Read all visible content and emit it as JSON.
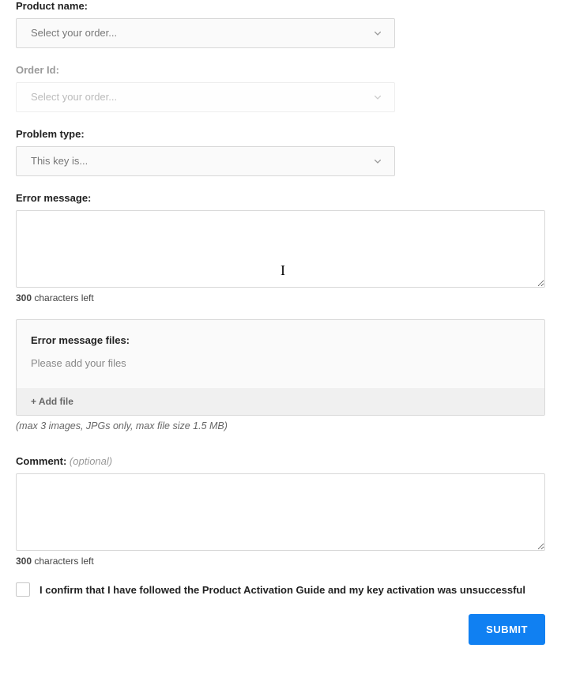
{
  "productName": {
    "label": "Product name:",
    "placeholder": "Select your order..."
  },
  "orderId": {
    "label": "Order Id:",
    "placeholder": "Select your order..."
  },
  "problemType": {
    "label": "Problem type:",
    "placeholder": "This key is..."
  },
  "errorMessage": {
    "label": "Error message:",
    "counterCount": "300",
    "counterText": " characters left"
  },
  "errorFiles": {
    "label": "Error message files:",
    "hint": "Please add your files",
    "addFile": "+ Add file",
    "note": "(max 3 images, JPGs only, max file size 1.5 MB)"
  },
  "comment": {
    "label": "Comment:",
    "optional": "(optional)",
    "counterCount": "300",
    "counterText": " characters left"
  },
  "confirm": {
    "text": "I confirm that I have followed the Product Activation Guide and my key activation was unsuccessful"
  },
  "submit": {
    "label": "SUBMIT"
  }
}
